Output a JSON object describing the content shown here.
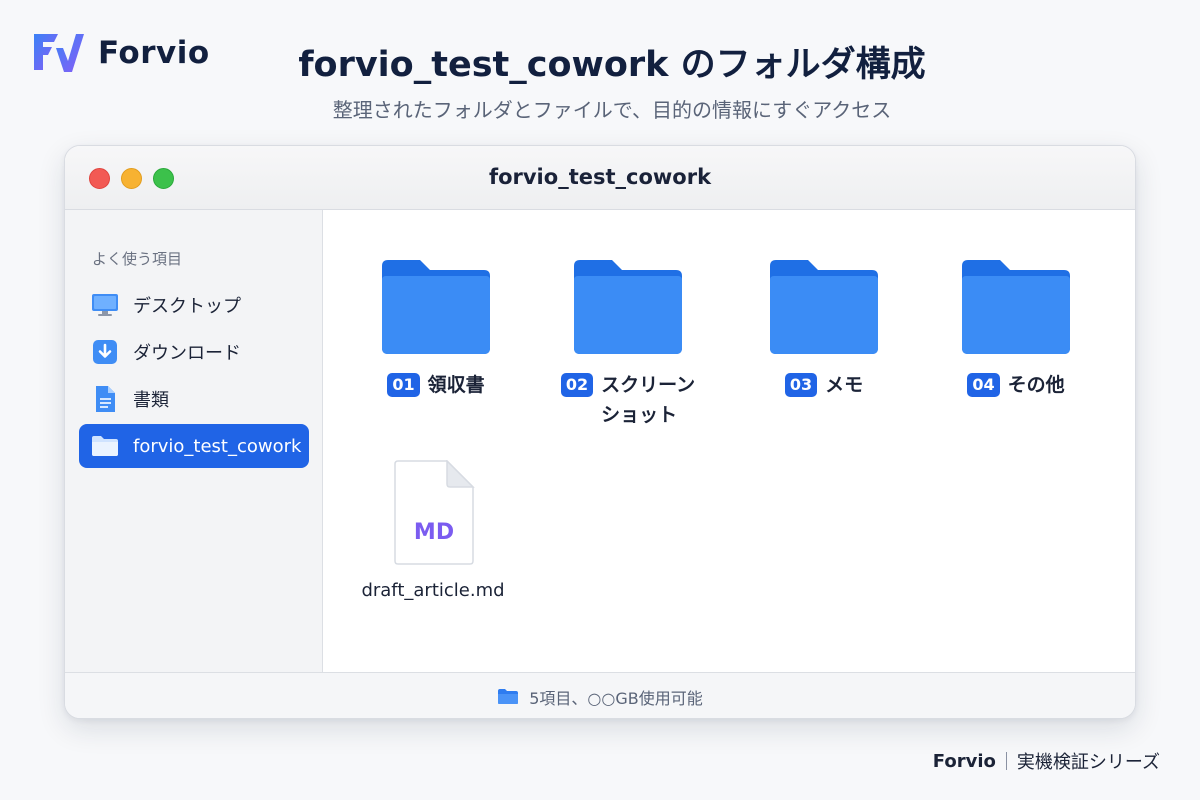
{
  "brand": {
    "name": "Forvio",
    "logo_icon": "forvio-logo-icon",
    "accent": "#4a6cf7"
  },
  "header": {
    "title": "forvio_test_cowork のフォルダ構成",
    "subtitle": "整理されたフォルダとファイルで、目的の情報にすぐアクセス"
  },
  "window": {
    "title": "forvio_test_cowork",
    "controls": [
      "close",
      "minimize",
      "zoom"
    ]
  },
  "sidebar": {
    "heading": "よく使う項目",
    "items": [
      {
        "label": "デスクトップ",
        "icon": "desktop-icon"
      },
      {
        "label": "ダウンロード",
        "icon": "download-icon"
      },
      {
        "label": "書類",
        "icon": "document-icon"
      },
      {
        "label": "forvio_test_cowork",
        "icon": "folder-icon",
        "active": true
      }
    ]
  },
  "main": {
    "folders": [
      {
        "number": "01",
        "name": "領収書"
      },
      {
        "number": "02",
        "name": "スクリーン",
        "name_line2": "ショット"
      },
      {
        "number": "03",
        "name": "メモ"
      },
      {
        "number": "04",
        "name": "その他"
      }
    ],
    "file": {
      "badge": "MD",
      "name": "draft_article.md",
      "badge_color": "#7b5cf0"
    }
  },
  "statusbar": {
    "text": "5項目、○○GB使用可能"
  },
  "footer": {
    "brand": "Forvio",
    "series": "実機検証シリーズ"
  }
}
